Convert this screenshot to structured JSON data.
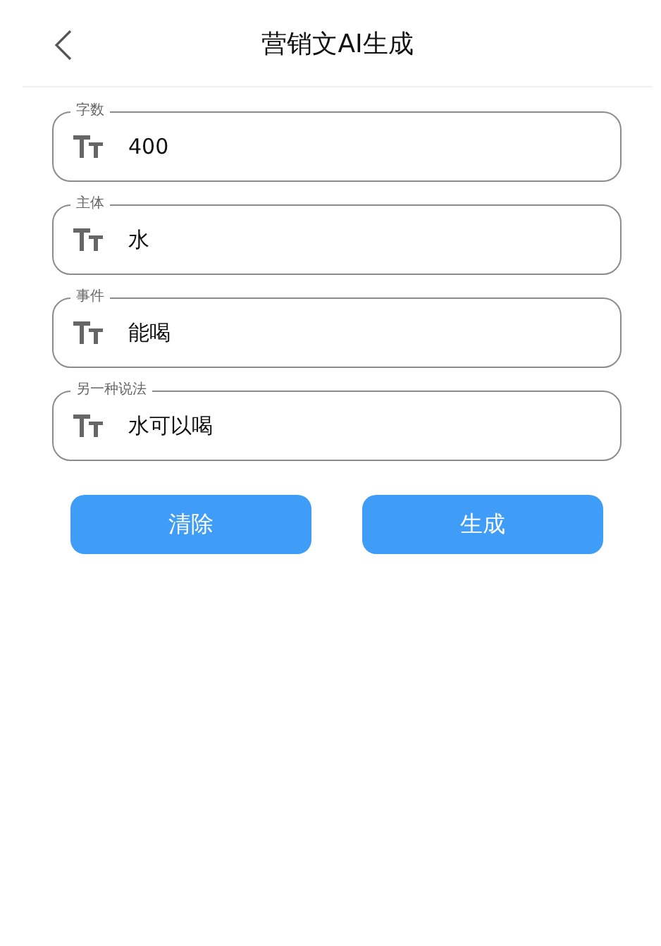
{
  "header": {
    "title": "营销文AI生成"
  },
  "fields": [
    {
      "label": "字数",
      "value": "400"
    },
    {
      "label": "主体",
      "value": "水"
    },
    {
      "label": "事件",
      "value": "能喝"
    },
    {
      "label": "另一种说法",
      "value": "水可以喝"
    }
  ],
  "buttons": [
    {
      "label": "清除"
    },
    {
      "label": "生成"
    }
  ]
}
